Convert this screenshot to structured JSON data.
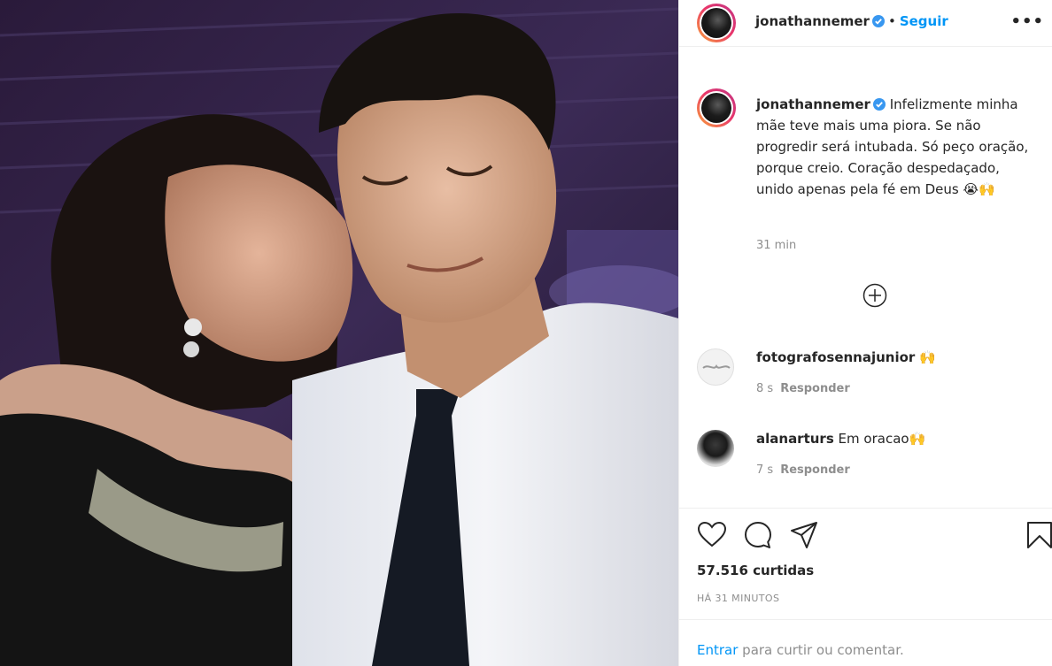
{
  "post": {
    "author": "jonathannemer",
    "follow_label": "Seguir",
    "separator": "•",
    "more_label": "•••",
    "caption": "Infelizmente minha mãe teve mais uma piora. Se não progredir será intubada. Só peço oração, porque creio. Coração despedaçado, unido apenas pela fé em Deus",
    "caption_emoji": "😭🙌",
    "caption_time": "31 min"
  },
  "comments": [
    {
      "username": "fotografosennajunior",
      "text": "🙌",
      "time": "8 s",
      "reply_label": "Responder"
    },
    {
      "username": "alanarturs",
      "text": "Em oracao🙌",
      "time": "7 s",
      "reply_label": "Responder"
    }
  ],
  "footer": {
    "likes": "57.516 curtidas",
    "posted_ago": "HÁ 31 MINUTOS",
    "login_link": "Entrar",
    "login_rest": " para curtir ou comentar."
  },
  "colors": {
    "accent": "#0095f6",
    "text": "#262626",
    "muted": "#8e8e8e",
    "divider": "#efefef"
  },
  "icons": [
    "verified-badge-icon",
    "more-options-icon",
    "add-comment-icon",
    "heart-icon",
    "comment-icon",
    "share-icon",
    "bookmark-icon"
  ]
}
